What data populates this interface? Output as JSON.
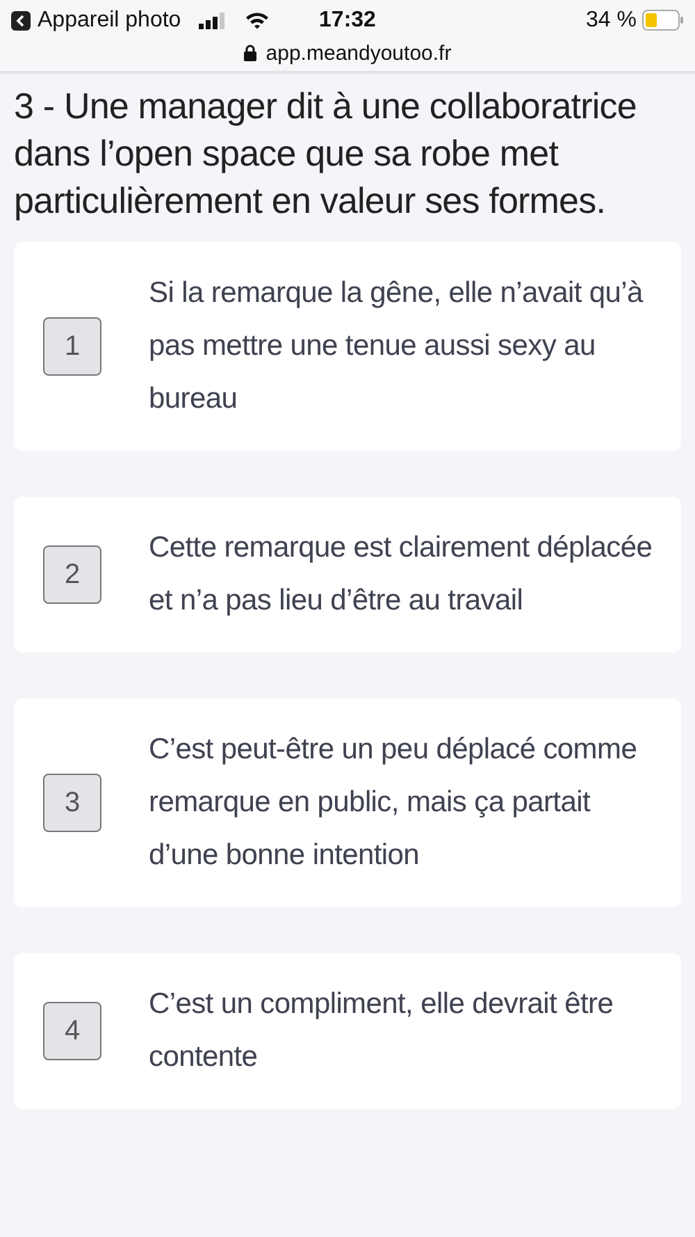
{
  "status_bar": {
    "back_label": "Appareil photo",
    "time": "17:32",
    "battery": "34 %",
    "url": "app.meandyoutoo.fr"
  },
  "question": "3 - Une manager dit à une collaboratrice dans l’open space que sa robe met particulièrement en valeur ses formes.",
  "answers": [
    {
      "number": "1",
      "text": "Si la remarque la gêne, elle n’avait qu’à pas mettre une tenue aussi sexy au bureau"
    },
    {
      "number": "2",
      "text": "Cette remarque est clairement déplacée et n’a pas lieu d’être au travail"
    },
    {
      "number": "3",
      "text": "C’est peut-être un peu déplacé comme remarque en public, mais ça partait d’une bonne intention"
    },
    {
      "number": "4",
      "text": "C’est un compliment, elle devrait être contente"
    }
  ]
}
